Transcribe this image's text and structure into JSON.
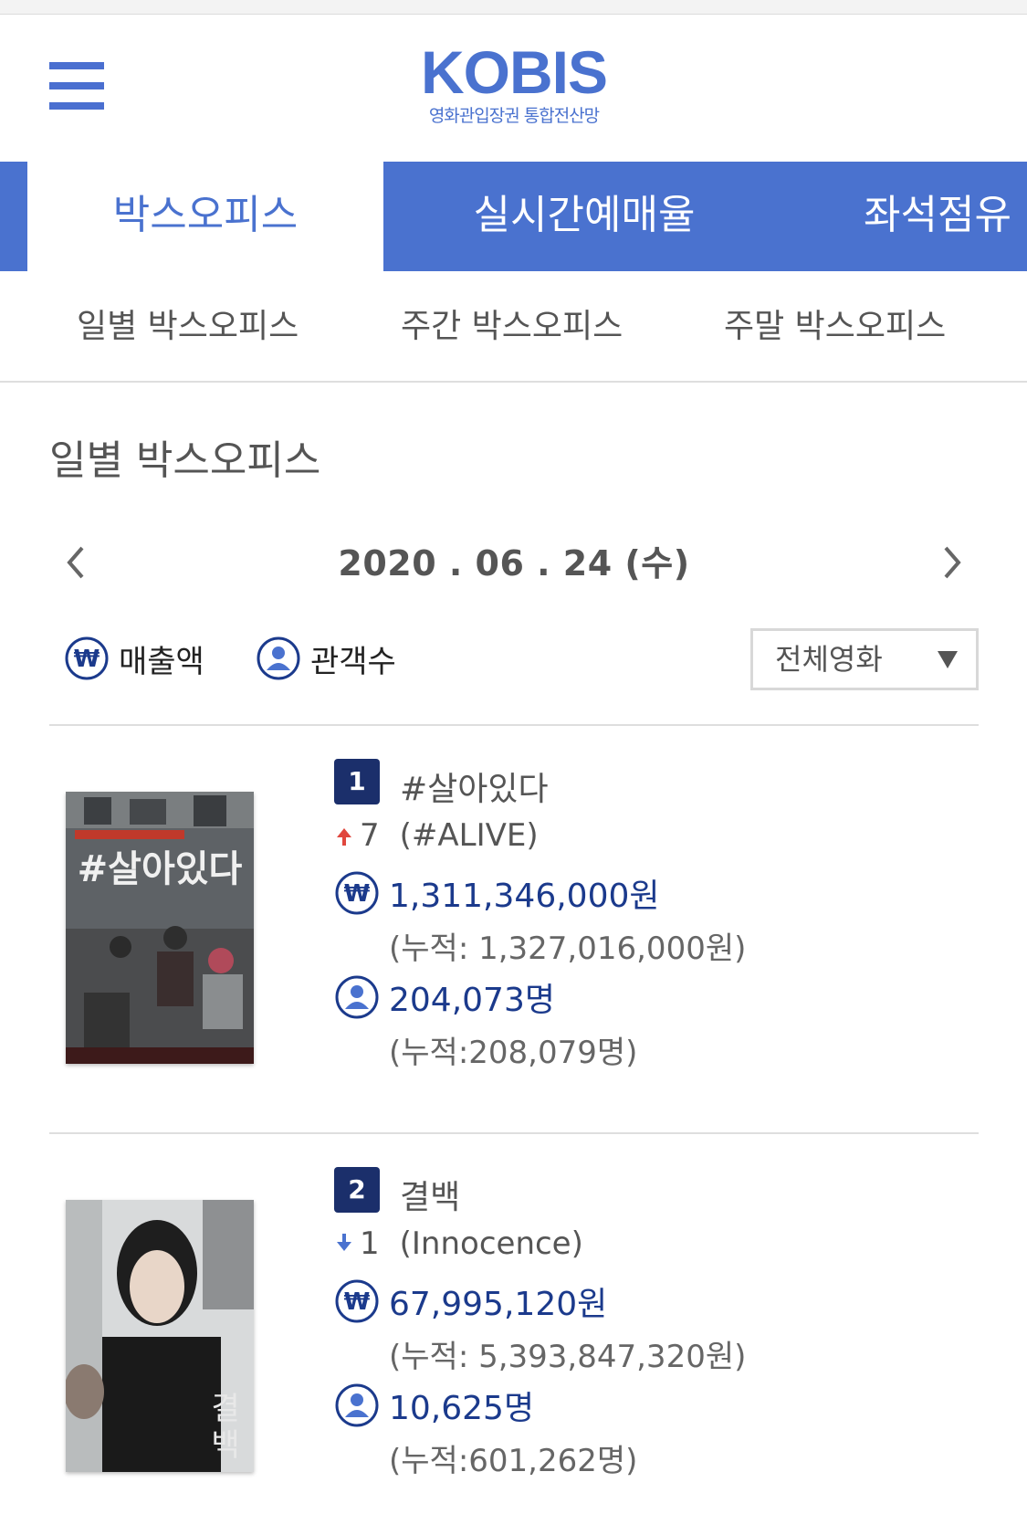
{
  "header": {
    "logo_title": "KOBIS",
    "logo_subtitle": "영화관입장권 통합전산망"
  },
  "main_tabs": [
    {
      "label": "박스오피스",
      "active": true
    },
    {
      "label": "실시간예매율",
      "active": false
    },
    {
      "label": "좌석점유",
      "active": false
    }
  ],
  "sub_tabs": [
    {
      "label": "일별 박스오피스"
    },
    {
      "label": "주간 박스오피스"
    },
    {
      "label": "주말 박스오피스"
    }
  ],
  "section_title": "일별 박스오피스",
  "date_nav": {
    "date": "2020 . 06 . 24 (수)",
    "prev_icon": "chevron-left-icon",
    "next_icon": "chevron-right-icon"
  },
  "filters": {
    "revenue_label": "매출액",
    "audience_label": "관객수",
    "select_value": "전체영화"
  },
  "movies": [
    {
      "rank": "1",
      "title_ko": "#살아있다",
      "change_direction": "up",
      "change_value": "7",
      "title_en": "(#ALIVE)",
      "revenue": "1,311,346,000원",
      "revenue_total": "(누적: 1,327,016,000원)",
      "audience": "204,073명",
      "audience_total": "(누적:208,079명)"
    },
    {
      "rank": "2",
      "title_ko": "결백",
      "change_direction": "down",
      "change_value": "1",
      "title_en": "(Innocence)",
      "revenue": "67,995,120원",
      "revenue_total": "(누적: 5,393,847,320원)",
      "audience": "10,625명",
      "audience_total": "(누적:601,262명)"
    }
  ],
  "colors": {
    "brand": "#4a72cf",
    "badge": "#1b2f6b",
    "stat_text": "#1b3a8c",
    "up_arrow": "#e0473e",
    "down_arrow": "#4a72cf"
  }
}
